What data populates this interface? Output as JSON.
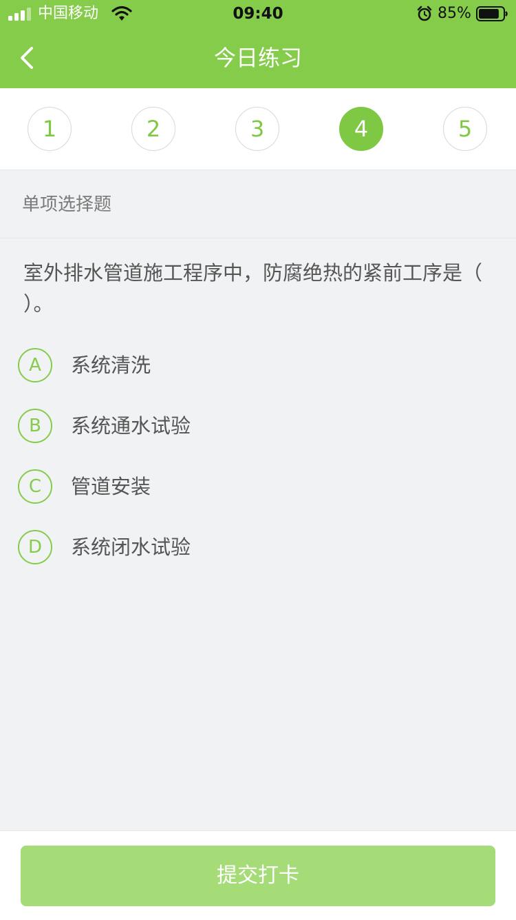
{
  "status_bar": {
    "carrier": "中国移动",
    "time": "09:40",
    "battery": "85%",
    "battery_level": 0.85,
    "signal_icon": "signal-bars-icon",
    "wifi_icon": "wifi-icon",
    "alarm_icon": "alarm-clock-icon"
  },
  "header": {
    "title": "今日练习",
    "back_icon": "chevron-left-icon",
    "background": "#85cc4b"
  },
  "question_nav": {
    "items": [
      {
        "label": "1",
        "active": false
      },
      {
        "label": "2",
        "active": false
      },
      {
        "label": "3",
        "active": false
      },
      {
        "label": "4",
        "active": true
      },
      {
        "label": "5",
        "active": false
      }
    ],
    "accent": "#7ec843"
  },
  "section": {
    "label": "单项选择题"
  },
  "question": {
    "text": "室外排水管道施工程序中，防腐绝热的紧前工序是（ ）。"
  },
  "options": [
    {
      "letter": "A",
      "text": "系统清洗"
    },
    {
      "letter": "B",
      "text": "系统通水试验"
    },
    {
      "letter": "C",
      "text": "管道安装"
    },
    {
      "letter": "D",
      "text": "系统闭水试验"
    }
  ],
  "footer": {
    "submit_label": "提交打卡",
    "button_color": "#a6dc78"
  }
}
